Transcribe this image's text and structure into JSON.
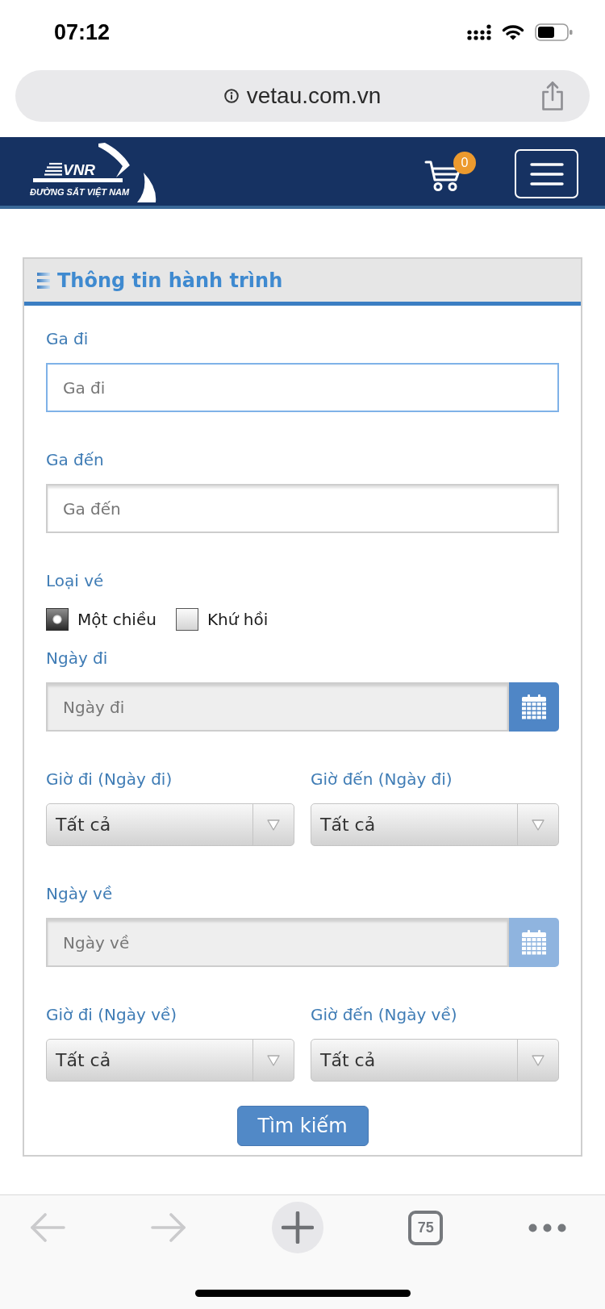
{
  "status_bar": {
    "time": "07:12"
  },
  "address_bar": {
    "url": "vetau.com.vn"
  },
  "site_header": {
    "logo": {
      "mark": "VNR",
      "tagline": "ĐƯỜNG SẮT VIỆT NAM"
    },
    "cart": {
      "count": "0"
    }
  },
  "form": {
    "title": "Thông tin hành trình",
    "fields": [
      {
        "kind": "text",
        "label": "Ga đi",
        "placeholder": "Ga đi",
        "focused": true
      },
      {
        "kind": "text",
        "label": "Ga đến",
        "placeholder": "Ga đến",
        "focused": false
      },
      {
        "kind": "radio",
        "label": "Loại vé",
        "options": [
          {
            "label": "Một chiều",
            "selected": true
          },
          {
            "label": "Khứ hồi",
            "selected": false
          }
        ]
      },
      {
        "kind": "date",
        "label": "Ngày đi",
        "placeholder": "Ngày đi",
        "disabled": false
      },
      {
        "kind": "select_pair",
        "selects": [
          {
            "label": "Giờ đi (Ngày đi)",
            "value": "Tất cả"
          },
          {
            "label": "Giờ đến (Ngày đi)",
            "value": "Tất cả"
          }
        ]
      },
      {
        "kind": "date",
        "label": "Ngày về",
        "placeholder": "Ngày về",
        "disabled": true
      },
      {
        "kind": "select_pair",
        "selects": [
          {
            "label": "Giờ đi (Ngày về)",
            "value": "Tất cả"
          },
          {
            "label": "Giờ đến (Ngày về)",
            "value": "Tất cả"
          }
        ]
      }
    ],
    "submit": "Tìm kiếm"
  },
  "browser_toolbar": {
    "back": {
      "disabled": true
    },
    "forward": {
      "disabled": true
    },
    "tab_count": "75"
  }
}
